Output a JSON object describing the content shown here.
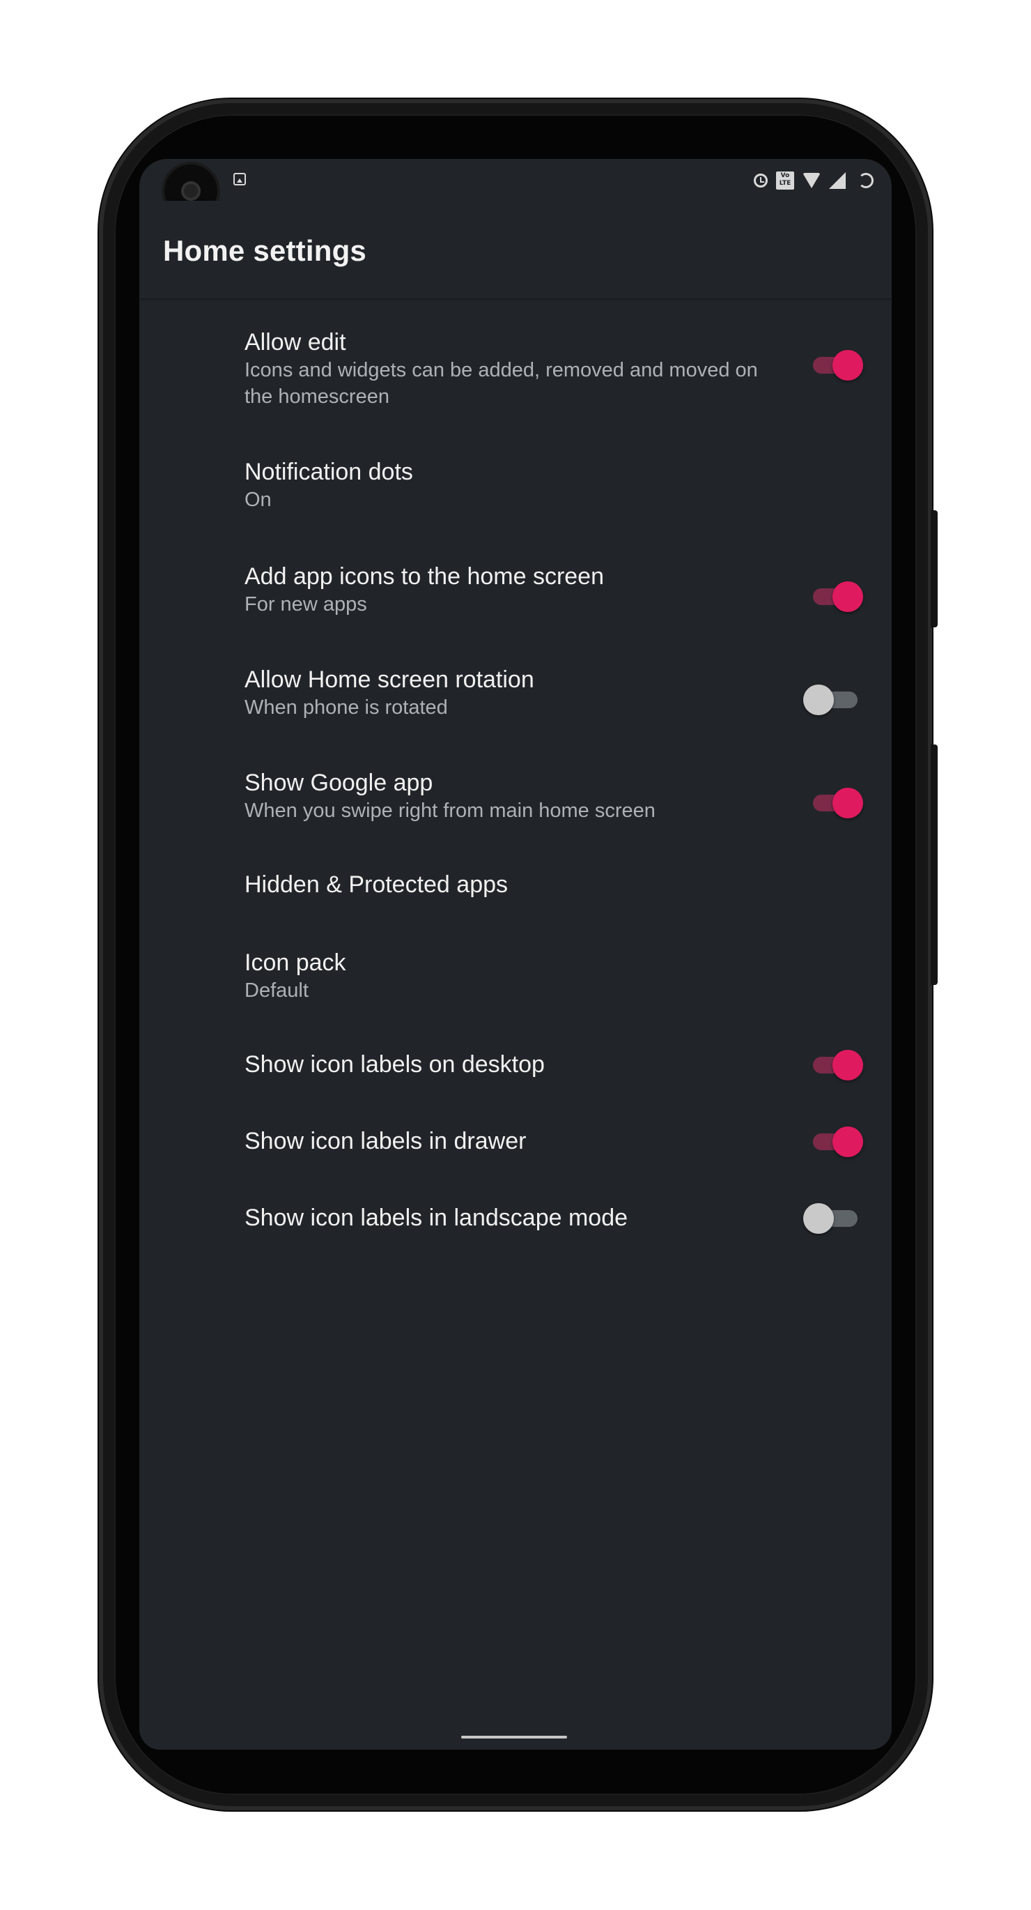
{
  "app_bar": {
    "title": "Home settings"
  },
  "status_bar": {
    "icons": [
      "image-icon",
      "alarm-icon",
      "volte-icon",
      "wifi-icon",
      "signal-icon",
      "battery-icon"
    ],
    "volte_text_top": "Vo",
    "volte_text_bottom": "LTE"
  },
  "settings": {
    "items": [
      {
        "title": "Allow edit",
        "subtitle": "Icons and widgets can be added, removed and moved on the homescreen",
        "toggle": true,
        "checked": true
      },
      {
        "title": "Notification dots",
        "subtitle": "On",
        "toggle": false
      },
      {
        "title": "Add app icons to the home screen",
        "subtitle": "For new apps",
        "toggle": true,
        "checked": true
      },
      {
        "title": "Allow Home screen rotation",
        "subtitle": "When phone is rotated",
        "toggle": true,
        "checked": false
      },
      {
        "title": "Show Google app",
        "subtitle": "When you swipe right from main home screen",
        "toggle": true,
        "checked": true
      },
      {
        "title": "Hidden & Protected apps",
        "toggle": false
      },
      {
        "title": "Icon pack",
        "subtitle": "Default",
        "toggle": false
      },
      {
        "title": "Show icon labels on desktop",
        "toggle": true,
        "checked": true
      },
      {
        "title": "Show icon labels in drawer",
        "toggle": true,
        "checked": true
      },
      {
        "title": "Show icon labels in landscape mode",
        "toggle": true,
        "checked": false
      }
    ]
  },
  "colors": {
    "background": "#212529",
    "accent": "#e01a5f",
    "accent_track": "#7d2a49",
    "off_thumb": "#c9c9c9",
    "off_track": "#5f6468",
    "text_primary": "#f1f1f1",
    "text_secondary": "#aeb2b6"
  }
}
